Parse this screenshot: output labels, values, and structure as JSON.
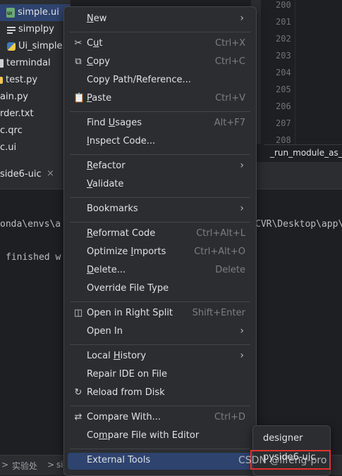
{
  "project_tree": {
    "items": [
      {
        "label": "simple.ui",
        "icon": "ui-file-icon",
        "selected": true
      },
      {
        "label": "simplpy",
        "icon": "text-file-icon"
      },
      {
        "label": "Ui_simple.",
        "icon": "python-file-icon"
      },
      {
        "label": "termindal",
        "icon": "folder-icon"
      },
      {
        "label": "test.py",
        "icon": "python-file-icon"
      },
      {
        "label": "ain.py",
        "icon": ""
      },
      {
        "label": "rder.txt",
        "icon": ""
      },
      {
        "label": "c.qrc",
        "icon": ""
      },
      {
        "label": "c.ui",
        "icon": ""
      }
    ]
  },
  "editor": {
    "line_numbers": [
      "200",
      "201",
      "202",
      "203",
      "204",
      "205",
      "206",
      "207",
      "208"
    ],
    "breadcrumb": "_run_module_as_"
  },
  "run_panel": {
    "tab_label": "side6-uic",
    "close_glyph": "×",
    "console_lines": [
      "onda\\envs\\a",
      "CVR\\Desktop\\app\\",
      "finished w"
    ]
  },
  "status_bar": {
    "left_glyph": ">",
    "item1": "实验处",
    "sep": ">",
    "item2": "si"
  },
  "context_menu": {
    "items": [
      {
        "label": "New",
        "mnemonic_index": 0,
        "icon": "",
        "shortcut": "",
        "submenu": true
      },
      {
        "label": "Cut",
        "mnemonic_index": 1,
        "icon": "scissors-icon",
        "shortcut": "Ctrl+X"
      },
      {
        "label": "Copy",
        "mnemonic_index": 0,
        "icon": "copy-icon",
        "shortcut": "Ctrl+C"
      },
      {
        "label": "Copy Path/Reference...",
        "icon": "",
        "shortcut": ""
      },
      {
        "label": "Paste",
        "mnemonic_index": 0,
        "icon": "paste-icon",
        "shortcut": "Ctrl+V"
      },
      {
        "label": "Find Usages",
        "mnemonic_index": 5,
        "icon": "",
        "shortcut": "Alt+F7"
      },
      {
        "label": "Inspect Code...",
        "mnemonic_index": 0,
        "icon": "",
        "shortcut": ""
      },
      {
        "label": "Refactor",
        "mnemonic_index": 0,
        "icon": "",
        "shortcut": "",
        "submenu": true
      },
      {
        "label": "Validate",
        "mnemonic_index": 0,
        "icon": "",
        "shortcut": ""
      },
      {
        "label": "Bookmarks",
        "icon": "",
        "shortcut": "",
        "submenu": true
      },
      {
        "label": "Reformat Code",
        "mnemonic_index": 0,
        "icon": "",
        "shortcut": "Ctrl+Alt+L"
      },
      {
        "label": "Optimize Imports",
        "mnemonic_index": 9,
        "icon": "",
        "shortcut": "Ctrl+Alt+O"
      },
      {
        "label": "Delete...",
        "mnemonic_index": 0,
        "icon": "",
        "shortcut": "Delete"
      },
      {
        "label": "Override File Type",
        "icon": "",
        "shortcut": ""
      },
      {
        "label": "Open in Right Split",
        "icon": "split-icon",
        "shortcut": "Shift+Enter"
      },
      {
        "label": "Open In",
        "icon": "",
        "shortcut": "",
        "submenu": true
      },
      {
        "label": "Local History",
        "mnemonic_index": 6,
        "icon": "",
        "shortcut": "",
        "submenu": true
      },
      {
        "label": "Repair IDE on File",
        "icon": "",
        "shortcut": ""
      },
      {
        "label": "Reload from Disk",
        "icon": "reload-icon",
        "shortcut": ""
      },
      {
        "label": "Compare With...",
        "icon": "compare-icon",
        "shortcut": "Ctrl+D"
      },
      {
        "label": "Compare File with Editor",
        "mnemonic_index": 2,
        "icon": "",
        "shortcut": ""
      },
      {
        "label": "External Tools",
        "icon": "",
        "shortcut": "",
        "active": true
      }
    ]
  },
  "submenu": {
    "items": [
      "designer",
      "pyside6-uic"
    ]
  },
  "watermark": "CSDN @lifeng-pro",
  "colors": {
    "background": "#1e1f22",
    "panel": "#2b2d30",
    "selection": "#2e436e",
    "highlight_box": "#e0322c"
  }
}
